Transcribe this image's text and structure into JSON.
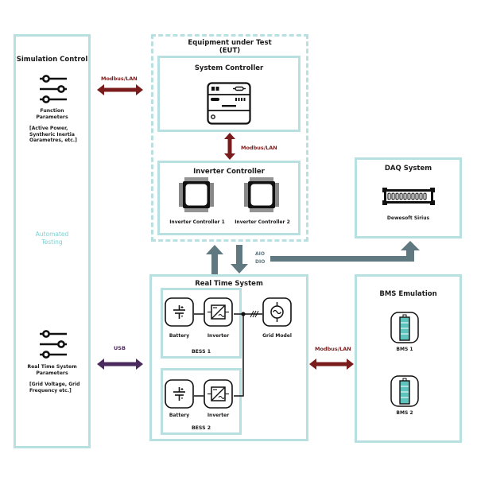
{
  "colors": {
    "box_border": "#b9e0e0",
    "modbus_arrow": "#7a1c1c",
    "usb_arrow": "#4b2a5e",
    "signal_arrow": "#607880",
    "automated_testing_text": "#7fcfcf",
    "battery_fill": "#5cc3bd"
  },
  "simulation_control": {
    "title": "Simulation Control",
    "function_parameters": {
      "icon": "sliders-icon",
      "label_line1": "Function",
      "label_line2": "Parameters",
      "detail_line1": "[Active Power,",
      "detail_line2": "Syntheric Inertia",
      "detail_line3": "Oarametres, etc.]"
    },
    "automated_testing_line1": "Automated",
    "automated_testing_line2": "Testing",
    "real_time_parameters": {
      "icon": "sliders-icon",
      "label_line1": "Real Time System",
      "label_line2": "Parameters",
      "detail_line1": "[Grid Voltage, Grid",
      "detail_line2": "Frequency etc.]"
    }
  },
  "links": {
    "sim_to_eut": "Modbus/LAN",
    "system_to_inverter": "Modbus/LAN",
    "sim_to_rts": "USB",
    "rts_to_bms": "Modbus/LAN",
    "aio": "AIO",
    "dio": "DIO"
  },
  "eut": {
    "title_line1": "Equipment under Test",
    "title_line2": "(EUT)",
    "system_controller": {
      "title": "System Controller",
      "icon": "controller-device-icon"
    },
    "inverter_controller": {
      "title": "Inverter Controller",
      "chips": [
        {
          "label": "Inverter Controller 1",
          "icon": "chip-icon"
        },
        {
          "label": "Inverter Controller 2",
          "icon": "chip-icon"
        }
      ]
    }
  },
  "daq": {
    "title": "DAQ System",
    "device_label": "Dewesoft Sirius",
    "icon": "daq-connector-icon"
  },
  "real_time_system": {
    "title": "Real Time System",
    "bess": [
      {
        "name": "BESS 1",
        "battery_label": "Battery",
        "inverter_label": "Inverter"
      },
      {
        "name": "BESS 2",
        "battery_label": "Battery",
        "inverter_label": "Inverter"
      }
    ],
    "grid_model_label": "Grid Model"
  },
  "bms_emulation": {
    "title": "BMS Emulation",
    "units": [
      {
        "label": "BMS 1"
      },
      {
        "label": "BMS 2"
      }
    ]
  }
}
